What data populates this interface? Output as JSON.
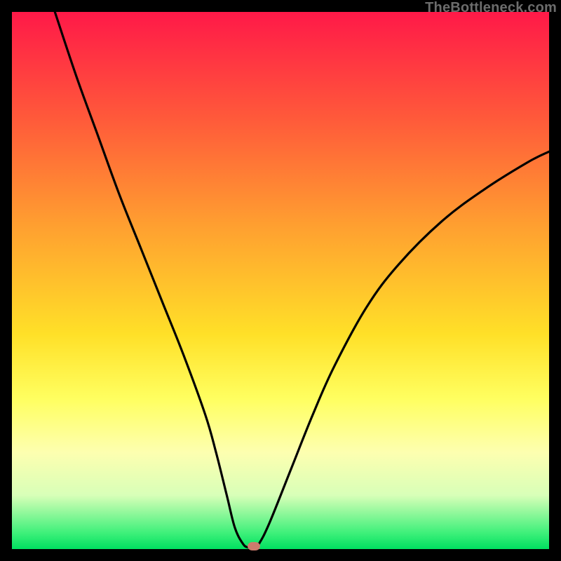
{
  "watermark": "TheBottleneck.com",
  "colors": {
    "frame_bg_top": "#ff1948",
    "frame_bg_bottom": "#00e060",
    "curve_stroke": "#000000",
    "dot_fill": "#cd7b6d",
    "page_bg": "#000000"
  },
  "chart_data": {
    "type": "line",
    "title": "",
    "xlabel": "",
    "ylabel": "",
    "xlim": [
      0,
      100
    ],
    "ylim": [
      0,
      100
    ],
    "grid": false,
    "legend": false,
    "series": [
      {
        "name": "bottleneck-curve",
        "x": [
          8,
          12,
          16,
          20,
          24,
          28,
          32,
          36,
          38,
          40,
          41.5,
          43,
          44,
          45,
          46,
          48,
          52,
          56,
          60,
          66,
          72,
          80,
          88,
          96,
          100
        ],
        "y": [
          100,
          88,
          77,
          66,
          56,
          46,
          36,
          25,
          18,
          10,
          4,
          1,
          0.3,
          0.3,
          1,
          5,
          15,
          25,
          34,
          45,
          53,
          61,
          67,
          72,
          74
        ]
      }
    ],
    "annotations": [
      {
        "type": "marker",
        "name": "selected-point",
        "x": 45,
        "y": 0.5
      }
    ]
  }
}
